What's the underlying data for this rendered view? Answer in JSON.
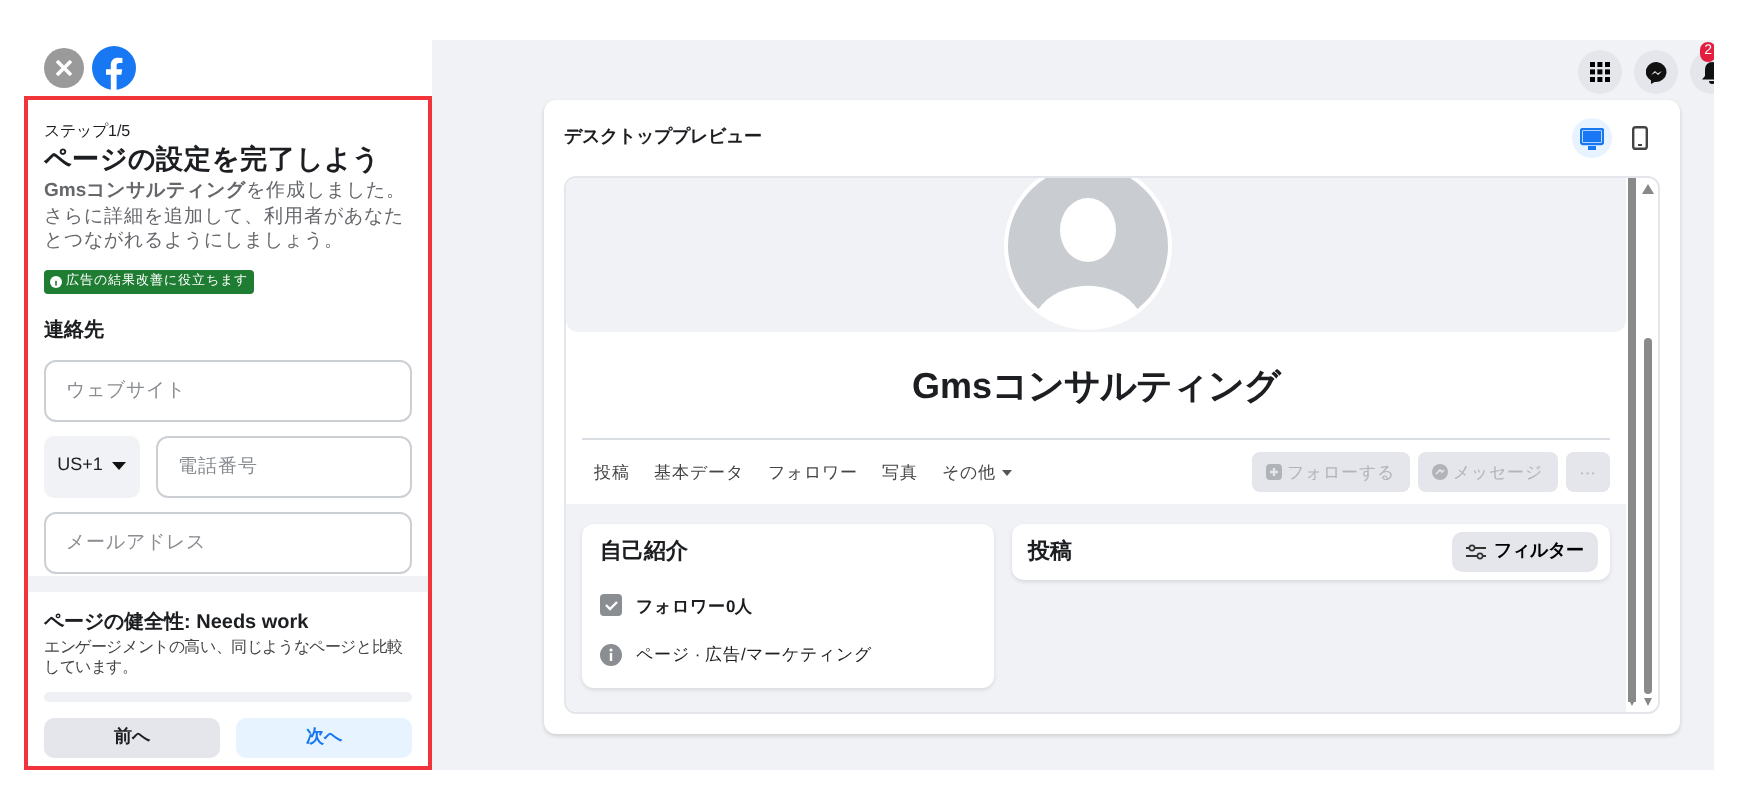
{
  "header": {
    "notification_count": "2"
  },
  "sidebar": {
    "step": "ステップ1/5",
    "title": "ページの設定を完了しよう",
    "description": "**Gmsコンサルティング**を作成しました。さらに詳細を追加して、利用者があなたとつながれるようにしましょう。",
    "badge": "広告の結果改善に役立ちます",
    "section": "連絡先",
    "fields": [
      {
        "kind": "text",
        "placeholder": "ウェブサイト"
      },
      {
        "kind": "phone",
        "country": "US+1",
        "placeholder": "電話番号"
      },
      {
        "kind": "text",
        "placeholder": "メールアドレス"
      }
    ],
    "health": {
      "title": "ページの健全性: Needs work",
      "description": "エンゲージメントの高い、同じようなページと比較しています。",
      "level": 0
    },
    "buttons": [
      {
        "label": "前へ",
        "kind": "secondary"
      },
      {
        "label": "次へ",
        "kind": "primary"
      }
    ]
  },
  "preview": {
    "title": "デスクトッププレビュー",
    "view_modes": [
      {
        "kind": "desktop",
        "selected": true
      },
      {
        "kind": "mobile",
        "selected": false
      }
    ],
    "page_name": "Gmsコンサルティング",
    "tabs": [
      {
        "label": "投稿",
        "dropdown": false
      },
      {
        "label": "基本データ",
        "dropdown": false
      },
      {
        "label": "フォロワー",
        "dropdown": false
      },
      {
        "label": "写真",
        "dropdown": false
      },
      {
        "label": "その他",
        "dropdown": true
      }
    ],
    "actions": [
      {
        "kind": "follow",
        "label": "フォローする",
        "disabled": true
      },
      {
        "kind": "message",
        "label": "メッセージ",
        "disabled": true
      },
      {
        "kind": "more",
        "label": "···",
        "disabled": true
      }
    ],
    "intro": {
      "title": "自己紹介",
      "items": [
        {
          "kind": "followers",
          "text": "**フォロワー0人**"
        },
        {
          "kind": "info",
          "text": "ページ · 広告/マーケティング"
        }
      ]
    },
    "posts": {
      "title": "投稿",
      "filter": "フィルター"
    }
  }
}
